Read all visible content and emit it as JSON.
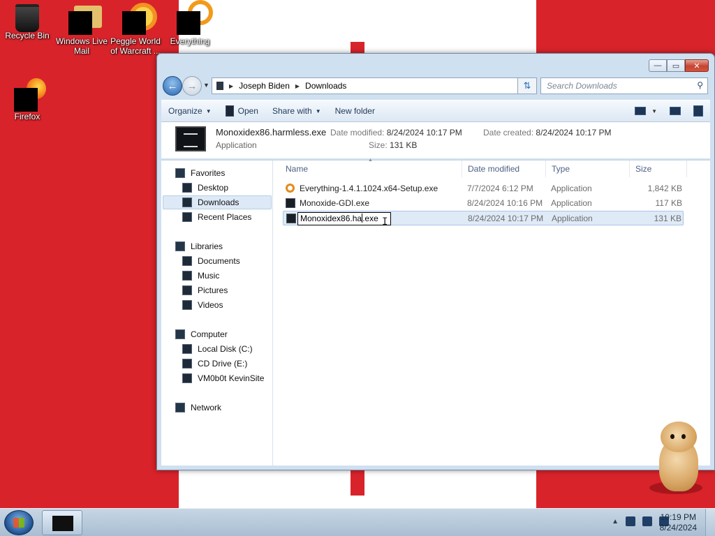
{
  "desktop": {
    "icons": [
      {
        "label": "Recycle Bin",
        "icon": "recycle-bin-icon"
      },
      {
        "label": "Windows Live Mail",
        "icon": "windows-live-mail-icon"
      },
      {
        "label": "Peggle World of Warcraft ...",
        "icon": "peggle-icon"
      },
      {
        "label": "Everything",
        "icon": "everything-icon"
      },
      {
        "label": "Firefox",
        "icon": "firefox-icon"
      }
    ]
  },
  "window": {
    "caption": {
      "minimize": "—",
      "maximize": "▭",
      "close": "✕"
    },
    "address": {
      "segments": [
        "Joseph Biden",
        "Downloads"
      ]
    },
    "search": {
      "placeholder": "Search Downloads"
    },
    "toolbar": {
      "organize": "Organize",
      "open": "Open",
      "share_with": "Share with",
      "new_folder": "New folder"
    },
    "details": {
      "name": "Monoxidex86.harmless.exe",
      "type": "Application",
      "date_modified_label": "Date modified:",
      "date_modified": "8/24/2024 10:17 PM",
      "size_label": "Size:",
      "size": "131 KB",
      "date_created_label": "Date created:",
      "date_created": "8/24/2024 10:17 PM"
    },
    "nav": {
      "favorites": "Favorites",
      "desktop": "Desktop",
      "downloads": "Downloads",
      "recent_places": "Recent Places",
      "libraries": "Libraries",
      "documents": "Documents",
      "music": "Music",
      "pictures": "Pictures",
      "videos": "Videos",
      "computer": "Computer",
      "local_disk": "Local Disk (C:)",
      "cd_drive": "CD Drive (E:)",
      "vm_site": "VM0b0t KevinSite",
      "network": "Network"
    },
    "columns": {
      "name": "Name",
      "date_modified": "Date modified",
      "type": "Type",
      "size": "Size"
    },
    "files": [
      {
        "name": "Everything-1.4.1.1024.x64-Setup.exe",
        "date": "7/7/2024 6:12 PM",
        "type": "Application",
        "size": "1,842 KB"
      },
      {
        "name": "Monoxide-GDI.exe",
        "date": "8/24/2024 10:16 PM",
        "type": "Application",
        "size": "117 KB"
      },
      {
        "name": "Monoxidex86.harmless.exe",
        "date": "8/24/2024 10:17 PM",
        "type": "Application",
        "size": "131 KB"
      }
    ],
    "rename": {
      "before_caret": "Monoxidex86.ha",
      "after_caret": ".exe"
    }
  },
  "taskbar": {
    "time": "10:19 PM",
    "date": "8/24/2024",
    "tray_expand": "▲"
  }
}
